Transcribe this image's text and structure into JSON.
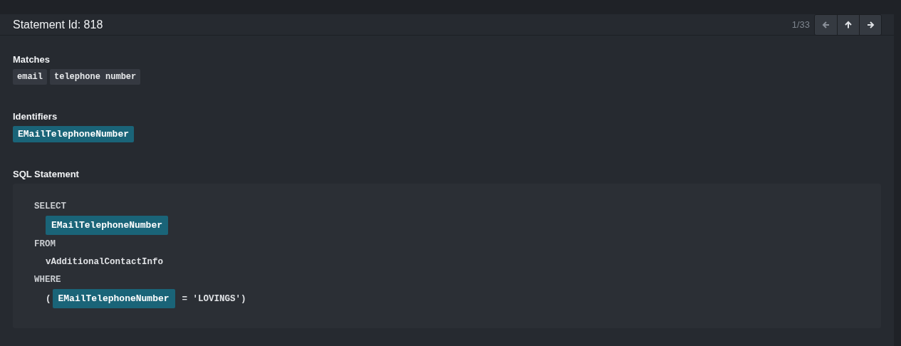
{
  "header": {
    "title": "Statement Id: 818",
    "pager": "1/33"
  },
  "matches": {
    "heading": "Matches",
    "tags": [
      "email",
      "telephone number"
    ]
  },
  "identifiers": {
    "heading": "Identifiers",
    "tags": [
      "EMailTelephoneNumber"
    ]
  },
  "sql": {
    "heading": "SQL Statement",
    "lines": [
      {
        "indented": false,
        "tokens": [
          {
            "kind": "keyword",
            "text": "SELECT"
          }
        ]
      },
      {
        "indented": true,
        "tokens": [
          {
            "kind": "identifier",
            "text": "EMailTelephoneNumber"
          }
        ]
      },
      {
        "indented": false,
        "tokens": [
          {
            "kind": "keyword",
            "text": "FROM"
          }
        ]
      },
      {
        "indented": true,
        "tokens": [
          {
            "kind": "plain",
            "text": "vAdditionalContactInfo"
          }
        ]
      },
      {
        "indented": false,
        "tokens": [
          {
            "kind": "keyword",
            "text": "WHERE"
          }
        ]
      },
      {
        "indented": true,
        "tokens": [
          {
            "kind": "plain",
            "text": "("
          },
          {
            "kind": "identifier",
            "text": "EMailTelephoneNumber"
          },
          {
            "kind": "plain",
            "text": "= 'LOVINGS')"
          }
        ]
      }
    ]
  }
}
